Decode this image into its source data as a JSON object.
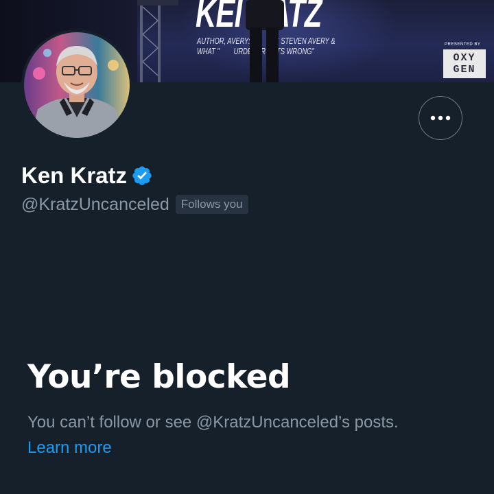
{
  "banner": {
    "title": "KEI  RATZ",
    "subtitle": "AUTHOR, AVERY:         NST STEVEN AVERY &\nWHAT \"        URDERER GETS WRONG\"",
    "presented_by": "PRESENTED BY",
    "network_logo_line1": "OXY",
    "network_logo_line2": "GEN"
  },
  "profile": {
    "display_name": "Ken Kratz",
    "verified": true,
    "handle": "@KratzUncanceled",
    "follows_you_label": "Follows you"
  },
  "actions": {
    "more_icon": "more-horizontal-icon"
  },
  "blocked": {
    "title": "You’re blocked",
    "description": "You can’t follow or see @KratzUncanceled’s posts.",
    "learn_more_label": "Learn more"
  },
  "colors": {
    "background": "#15202b",
    "text_primary": "#ffffff",
    "text_secondary": "#8b98a5",
    "accent": "#1d9bf0",
    "badge_bg": "#273340"
  }
}
